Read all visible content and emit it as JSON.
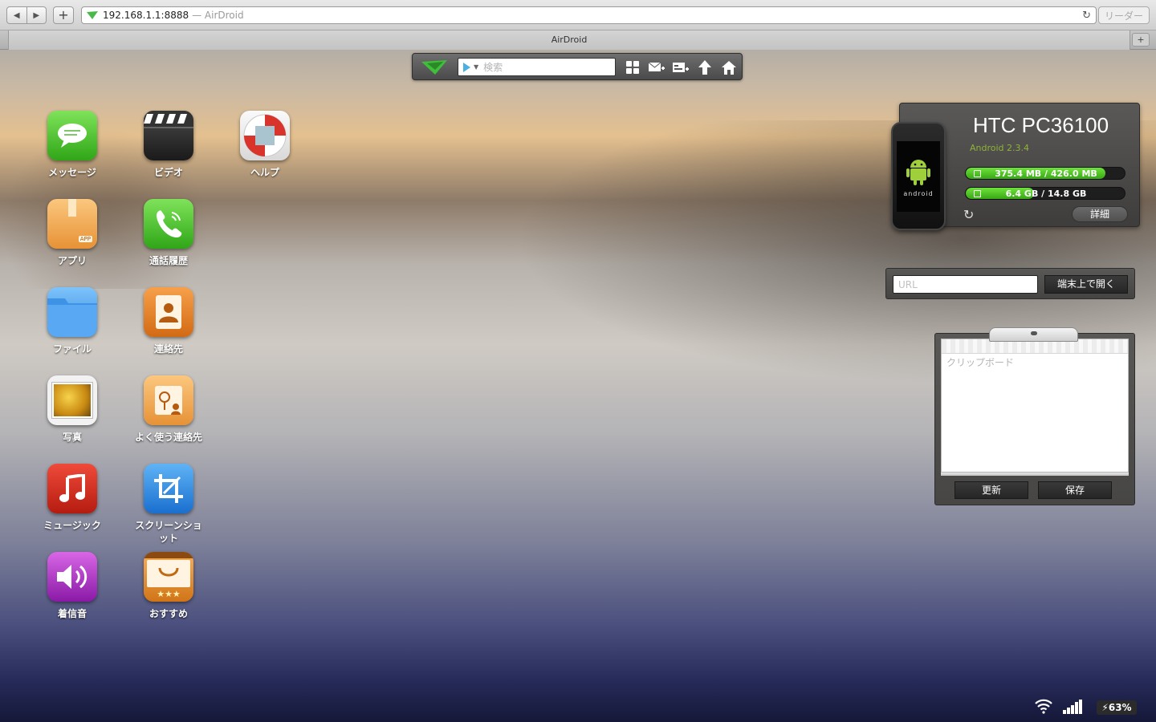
{
  "browser": {
    "address": "192.168.1.1:8888",
    "title_suffix": "— AirDroid",
    "reader_label": "リーダー",
    "tab_title": "AirDroid",
    "new_tab": "+"
  },
  "toolbar": {
    "search_placeholder": "検索",
    "icons": [
      "apps-grid-icon",
      "new-message-icon",
      "add-contact-icon",
      "upload-icon",
      "home-icon"
    ]
  },
  "apps": [
    {
      "label": "メッセージ",
      "icon": "messages-icon"
    },
    {
      "label": "ビデオ",
      "icon": "video-clapper-icon"
    },
    {
      "label": "ヘルプ",
      "icon": "lifebuoy-icon"
    },
    {
      "label": "アプリ",
      "icon": "app-box-icon"
    },
    {
      "label": "通話履歴",
      "icon": "phone-icon"
    },
    {
      "label": "ファイル",
      "icon": "folder-icon"
    },
    {
      "label": "連絡先",
      "icon": "contacts-icon"
    },
    {
      "label": "写真",
      "icon": "photo-icon"
    },
    {
      "label": "よく使う連絡先",
      "icon": "favorite-contacts-icon"
    },
    {
      "label": "ミュージック",
      "icon": "music-icon"
    },
    {
      "label": "スクリーンショット",
      "icon": "screenshot-crop-icon"
    },
    {
      "label": "着信音",
      "icon": "ringtone-speaker-icon"
    },
    {
      "label": "おすすめ",
      "icon": "recommended-bag-icon"
    }
  ],
  "device": {
    "name": "HTC PC36100",
    "os": "Android 2.3.4",
    "phone_brand": "android",
    "memory": {
      "text": "375.4 MB / 426.0 MB",
      "used_fraction": 0.88
    },
    "storage": {
      "text": "6.4 GB / 14.8 GB",
      "used_fraction": 0.43
    },
    "detail_label": "詳細"
  },
  "url_open": {
    "placeholder": "URL",
    "button_label": "端末上で開く"
  },
  "clipboard": {
    "placeholder": "クリップボード",
    "refresh_label": "更新",
    "save_label": "保存"
  },
  "status": {
    "battery": "63%"
  },
  "colors": {
    "accent_green": "#38a815",
    "panel_dark": "#4a4947",
    "os_text": "#8fb23a"
  }
}
